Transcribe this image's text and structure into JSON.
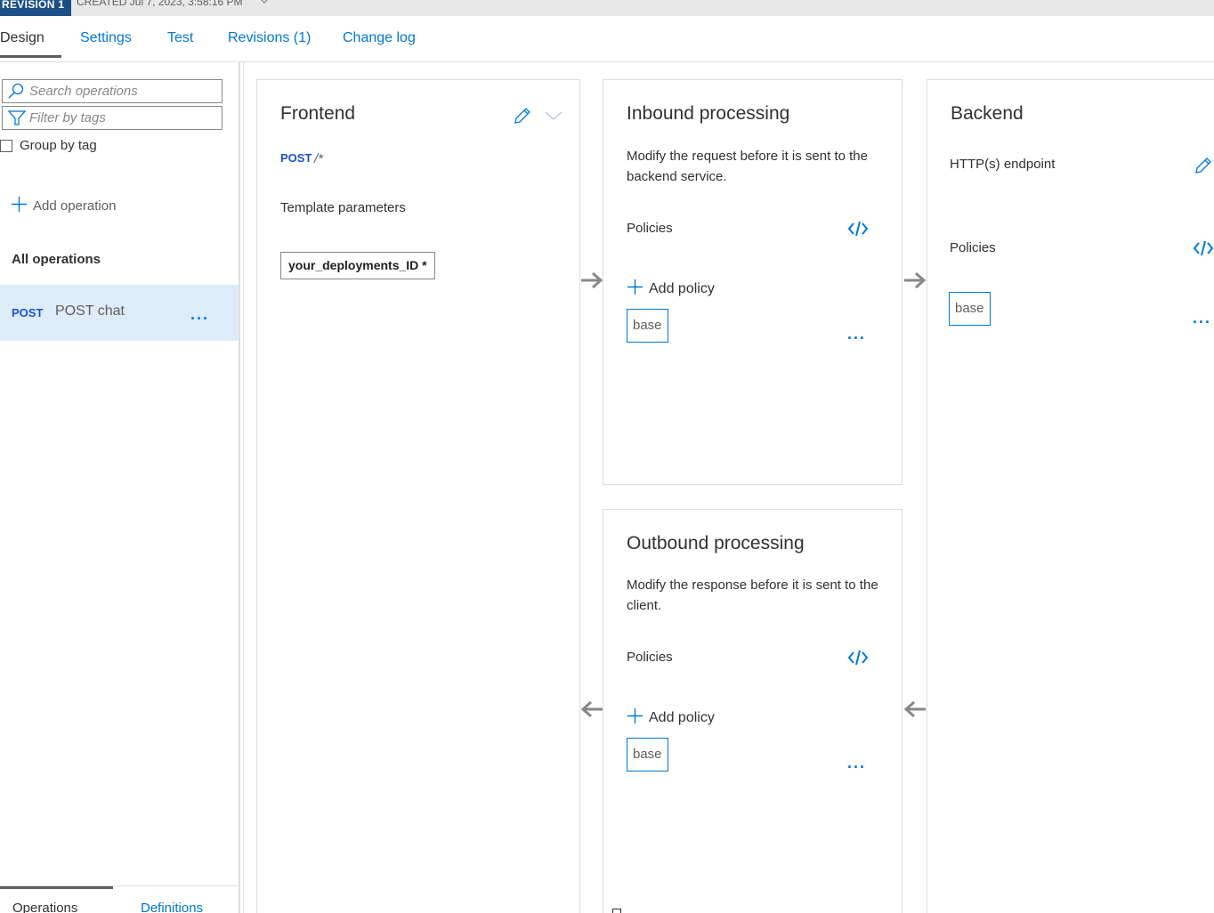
{
  "revision": {
    "badge": "REVISION 1",
    "created": "CREATED Jul 7, 2023, 3:58:16 PM"
  },
  "tabs": [
    {
      "label": "Design"
    },
    {
      "label": "Settings"
    },
    {
      "label": "Test"
    },
    {
      "label": "Revisions (1)"
    },
    {
      "label": "Change log"
    }
  ],
  "left_panel": {
    "search_placeholder": "Search operations",
    "filter_placeholder": "Filter by tags",
    "group_by_tag": "Group by tag",
    "add_operation": "Add operation",
    "all_operations": "All operations",
    "operations": [
      {
        "method": "POST",
        "name": "POST chat",
        "more": "..."
      }
    ],
    "bottom_tabs": [
      "Operations",
      "Definitions"
    ]
  },
  "frontend": {
    "title": "Frontend",
    "method": "POST",
    "path": "/*",
    "template_parameters_label": "Template parameters",
    "parameter": "your_deployments_ID *"
  },
  "inbound": {
    "title": "Inbound processing",
    "description": "Modify the request before it is sent to the backend service.",
    "policies_label": "Policies",
    "add_policy": "Add policy",
    "base": "base",
    "more": "..."
  },
  "outbound": {
    "title": "Outbound processing",
    "description": "Modify the response before it is sent to the client.",
    "policies_label": "Policies",
    "add_policy": "Add policy",
    "base": "base",
    "more": "..."
  },
  "backend": {
    "title": "Backend",
    "endpoint": "HTTP(s) endpoint",
    "policies_label": "Policies",
    "base": "base",
    "more": "..."
  },
  "colors": {
    "accent": "#0078d4",
    "revision_badge": "#1c4f86",
    "selected_row": "#deecf9",
    "method_post": "#1f4fd0"
  },
  "icons": {
    "search": "search-icon",
    "filter": "filter-icon",
    "add": "plus-icon",
    "edit": "pencil-icon",
    "code": "code-icon",
    "collapse": "chevron-down-icon",
    "arrow_right": "arrow-right-icon",
    "arrow_left": "arrow-left-icon"
  }
}
